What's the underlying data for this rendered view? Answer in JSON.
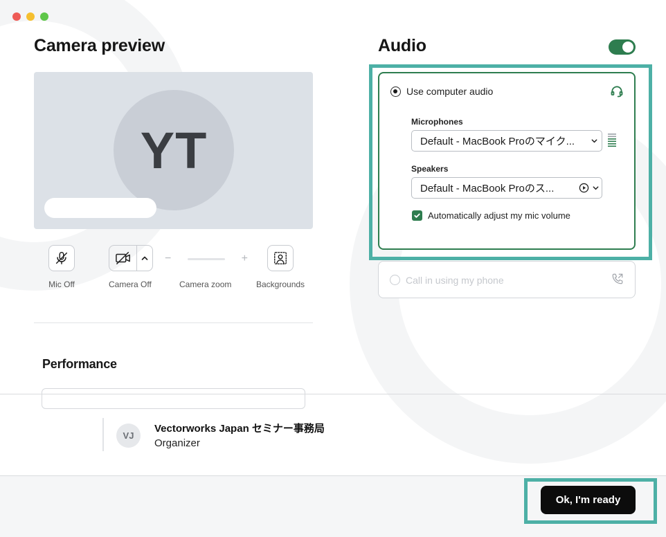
{
  "camera": {
    "title": "Camera preview",
    "initials": "YT",
    "controls": {
      "mic_label": "Mic Off",
      "camera_label": "Camera Off",
      "zoom_label": "Camera zoom",
      "zoom_minus": "−",
      "zoom_plus": "+",
      "backgrounds_label": "Backgrounds"
    }
  },
  "performance": {
    "title": "Performance"
  },
  "audio": {
    "title": "Audio",
    "toggle_on": true,
    "computer_audio_label": "Use computer audio",
    "microphones_label": "Microphones",
    "microphone_value": "Default - MacBook Proのマイク...",
    "speakers_label": "Speakers",
    "speaker_value": "Default - MacBook Proのス...",
    "auto_adjust_label": "Automatically adjust my mic volume",
    "auto_adjust_checked": true,
    "call_in_label": "Call in using my phone"
  },
  "organizer": {
    "initials": "VJ",
    "name": "Vectorworks Japan セミナー事務局",
    "role": "Organizer"
  },
  "footer": {
    "ready_label": "Ok, I'm ready"
  },
  "colors": {
    "accent_green": "#2e7d4f",
    "highlight_teal": "#4db0a6",
    "button_black": "#0c0c0c"
  }
}
